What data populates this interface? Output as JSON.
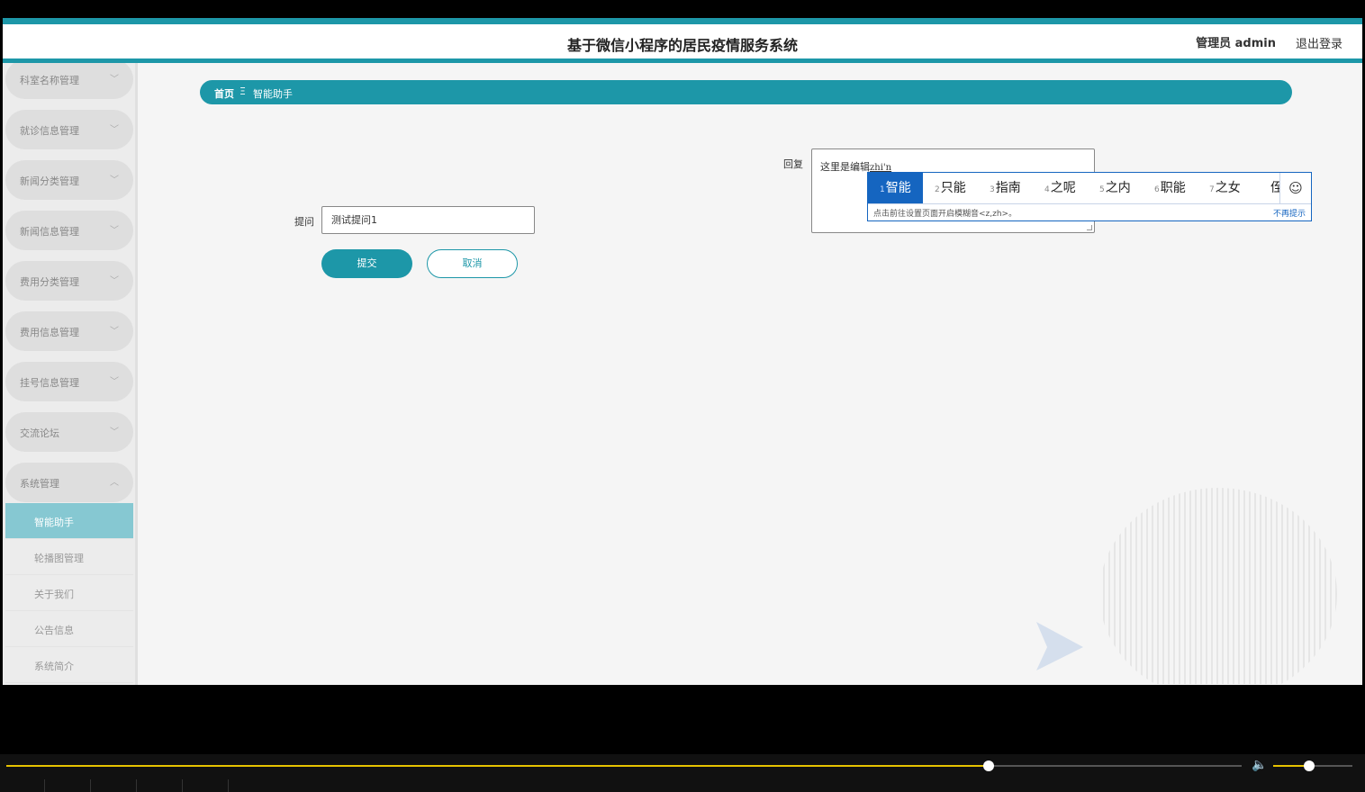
{
  "header": {
    "title": "基于微信小程序的居民疫情服务系统",
    "admin": "管理员 admin",
    "logout": "退出登录"
  },
  "sidebar": {
    "menus": [
      {
        "label": "科室名称管理"
      },
      {
        "label": "就诊信息管理"
      },
      {
        "label": "新闻分类管理"
      },
      {
        "label": "新闻信息管理"
      },
      {
        "label": "费用分类管理"
      },
      {
        "label": "费用信息管理"
      },
      {
        "label": "挂号信息管理"
      },
      {
        "label": "交流论坛"
      },
      {
        "label": "系统管理"
      }
    ],
    "sub_items": [
      {
        "label": "智能助手",
        "active": true
      },
      {
        "label": "轮播图管理"
      },
      {
        "label": "关于我们"
      },
      {
        "label": "公告信息"
      },
      {
        "label": "系统简介"
      }
    ]
  },
  "breadcrumb": {
    "home": "首页",
    "separator": "Ξ",
    "current": "智能助手"
  },
  "form": {
    "ask_label": "提问",
    "ask_value": "测试提问1",
    "reply_label": "回复",
    "reply_text": "这里是编辑",
    "reply_composing": "zhi'n",
    "submit": "提交",
    "cancel": "取消"
  },
  "ime": {
    "candidates": [
      {
        "num": "1",
        "text": "智能",
        "selected": true
      },
      {
        "num": "2",
        "text": "只能"
      },
      {
        "num": "3",
        "text": "指南"
      },
      {
        "num": "4",
        "text": "之呢"
      },
      {
        "num": "5",
        "text": "之内"
      },
      {
        "num": "6",
        "text": "职能"
      },
      {
        "num": "7",
        "text": "之女"
      },
      {
        "num": "",
        "text": "侄"
      }
    ],
    "emoji_icon": "smiley-icon",
    "tip": "点击前往设置页面开启模糊音<z,zh>。",
    "dismiss": "不再提示"
  },
  "player": {
    "progress": 0.795,
    "volume": 0.45
  },
  "colors": {
    "accent": "#1d97a8",
    "active_sub": "#86c8d2",
    "ime_select": "#1565c0",
    "progress": "#e6c200"
  }
}
